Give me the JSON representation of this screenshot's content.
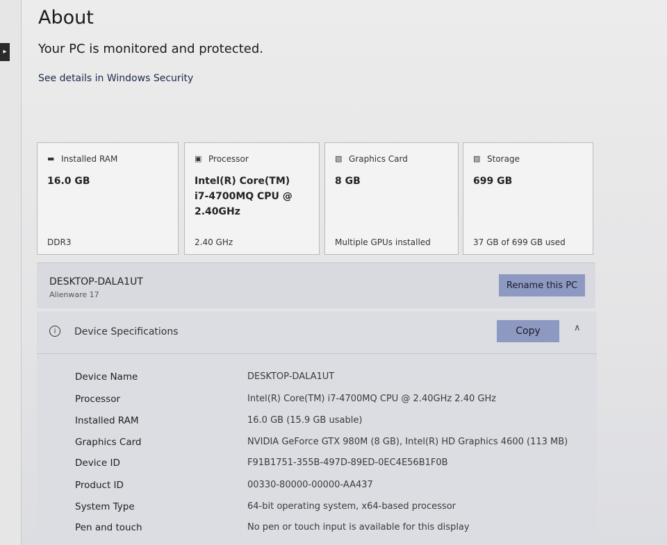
{
  "page": {
    "title": "About",
    "protection_status": "Your PC is monitored and protected.",
    "security_link": "See details in Windows Security"
  },
  "cards": [
    {
      "icon": "ram-icon",
      "label": "Installed RAM",
      "value": "16.0 GB",
      "foot": "DDR3"
    },
    {
      "icon": "processor-icon",
      "label": "Processor",
      "value": "Intel(R) Core(TM) i7-4700MQ CPU @ 2.40GHz",
      "foot": "2.40 GHz"
    },
    {
      "icon": "graphics-card-icon",
      "label": "Graphics Card",
      "value": "8 GB",
      "foot": "Multiple GPUs installed"
    },
    {
      "icon": "storage-icon",
      "label": "Storage",
      "value": "699 GB",
      "foot": "37 GB of 699 GB used"
    }
  ],
  "pc": {
    "name": "DESKTOP-DALA1UT",
    "model": "Alienware 17",
    "rename_label": "Rename this PC"
  },
  "specs": {
    "title": "Device Specifications",
    "copy_label": "Copy",
    "rows": [
      {
        "label": "Device Name",
        "value": "DESKTOP-DALA1UT"
      },
      {
        "label": "Processor",
        "value": "Intel(R) Core(TM) i7-4700MQ CPU @ 2.40GHz   2.40 GHz"
      },
      {
        "label": "Installed RAM",
        "value": "16.0 GB (15.9 GB usable)"
      },
      {
        "label": "Graphics Card",
        "value": "NVIDIA GeForce GTX 980M (8 GB), Intel(R) HD Graphics 4600 (113 MB)"
      },
      {
        "label": "Device ID",
        "value": "F91B1751-355B-497D-89ED-0EC4E56B1F0B"
      },
      {
        "label": "Product ID",
        "value": "00330-80000-00000-AA437"
      },
      {
        "label": "System Type",
        "value": "64-bit operating system, x64-based processor"
      },
      {
        "label": "Pen and touch",
        "value": "No pen or touch input is available for this display"
      }
    ]
  }
}
